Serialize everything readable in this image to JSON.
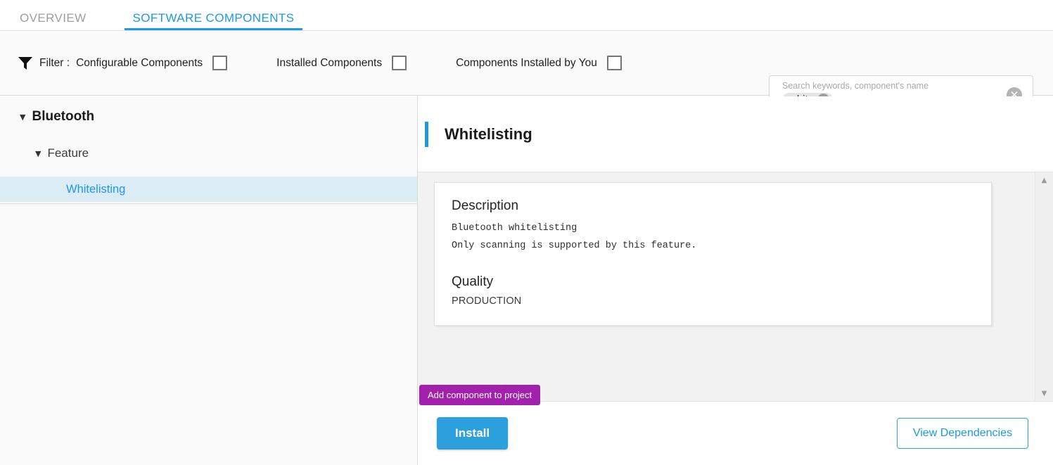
{
  "tabs": [
    {
      "label": "OVERVIEW",
      "active": false
    },
    {
      "label": "SOFTWARE COMPONENTS",
      "active": true
    }
  ],
  "filter": {
    "icon": "funnel-icon",
    "label": "Filter :",
    "options": [
      {
        "label": "Configurable Components",
        "checked": false
      },
      {
        "label": "Installed Components",
        "checked": false
      },
      {
        "label": "Components Installed by You",
        "checked": false
      }
    ]
  },
  "search": {
    "placeholder": "Search keywords, component's name",
    "chips": [
      {
        "label": "white"
      }
    ],
    "clear_icon": "close-circle-icon"
  },
  "tree": {
    "root": {
      "label": "Bluetooth",
      "expanded": true,
      "caret": "▼"
    },
    "group": {
      "label": "Feature",
      "expanded": true,
      "caret": "▼"
    },
    "leaf": {
      "label": "Whitelisting",
      "selected": true
    }
  },
  "detail": {
    "title": "Whitelisting",
    "description_heading": "Description",
    "description_lines": [
      "Bluetooth whitelisting",
      "Only scanning is supported by this feature."
    ],
    "quality_heading": "Quality",
    "quality_value": "PRODUCTION"
  },
  "tooltip": {
    "text": "Add component to project"
  },
  "actions": {
    "install_label": "Install",
    "dependencies_label": "View Dependencies"
  },
  "scrollbar": {
    "up_arrow": "▲",
    "down_arrow": "▼"
  },
  "colors": {
    "accent_blue": "#1e9ae0",
    "button_blue": "#2ba0dc",
    "tooltip_purple": "#a220ab",
    "selection_blue": "#dbecf5",
    "panel_gray": "#f2f2f2"
  }
}
